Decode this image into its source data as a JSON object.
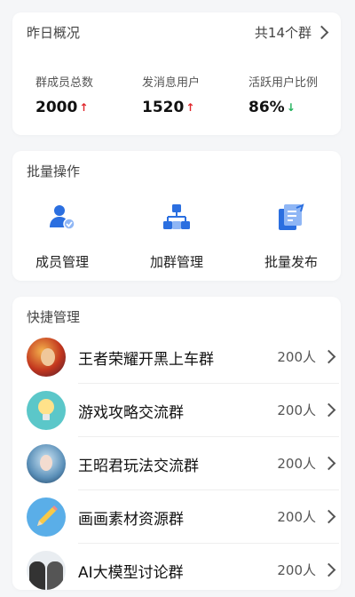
{
  "overview": {
    "title": "昨日概况",
    "group_count_label": "共14个群",
    "stats": [
      {
        "label": "群成员总数",
        "value": "2000",
        "trend": "up"
      },
      {
        "label": "发消息用户",
        "value": "1520",
        "trend": "up"
      },
      {
        "label": "活跃用户比例",
        "value": "86%",
        "trend": "down"
      }
    ]
  },
  "batch": {
    "title": "批量操作",
    "ops": [
      {
        "label": "成员管理",
        "icon": "member-manage-icon"
      },
      {
        "label": "加群管理",
        "icon": "org-chart-icon"
      },
      {
        "label": "批量发布",
        "icon": "batch-publish-icon"
      }
    ]
  },
  "quick": {
    "title": "快捷管理",
    "groups": [
      {
        "name": "王者荣耀开黑上车群",
        "count": "200人",
        "avatar": "game-hero-avatar"
      },
      {
        "name": "游戏攻略交流群",
        "count": "200人",
        "avatar": "lightbulb-avatar"
      },
      {
        "name": "王昭君玩法交流群",
        "count": "200人",
        "avatar": "character-avatar"
      },
      {
        "name": "画画素材资源群",
        "count": "200人",
        "avatar": "pencil-avatar"
      },
      {
        "name": "AI大模型讨论群",
        "count": "200人",
        "avatar": "people-avatar"
      }
    ]
  },
  "colors": {
    "accent": "#2b6fe0",
    "up": "#e0262b",
    "down": "#20b15a"
  }
}
